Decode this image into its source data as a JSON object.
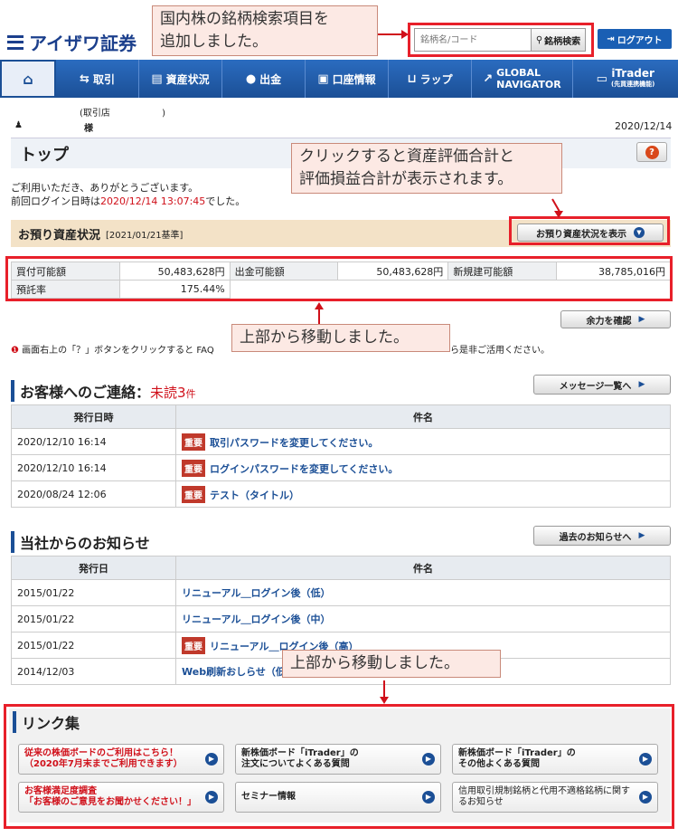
{
  "header": {
    "logo_text": "アイザワ証券",
    "search_placeholder": "銘柄名/コード",
    "search_button": "銘柄検索",
    "logout_label": "ログアウト"
  },
  "nav": {
    "items": [
      {
        "label": "取引",
        "icon": "exchange-icon"
      },
      {
        "label": "資産状況",
        "icon": "assets-icon"
      },
      {
        "label": "出金",
        "icon": "money-bag-icon"
      },
      {
        "label": "口座情報",
        "icon": "account-icon"
      },
      {
        "label": "ラップ",
        "icon": "wrap-icon"
      },
      {
        "label1": "GLOBAL",
        "label2": "NAVIGATOR",
        "icon": "external-icon"
      },
      {
        "label1": "iTrader",
        "label2": "(先買連携機能)",
        "icon": "monitor-icon"
      }
    ]
  },
  "user": {
    "branch": "(取引店",
    "branch_close": ")",
    "name_suffix": "様",
    "date": "2020/12/14"
  },
  "page": {
    "title": "トップ",
    "welcome": "ご利用いただき、ありがとうございます。",
    "last_login_prefix": "前回ログイン日時は",
    "last_login_time": "2020/12/14 13:07:45",
    "last_login_suffix": "でした。"
  },
  "assets": {
    "title": "お預り資産状況",
    "basis": "[2021/01/21基準]",
    "show_button": "お預り資産状況を表示",
    "rows": [
      {
        "l1": "買付可能額",
        "v1": "50,483,628円",
        "l2": "出金可能額",
        "v2": "50,483,628円",
        "l3": "新規建可能額",
        "v3": "38,785,016円"
      },
      {
        "l1": "預託率",
        "v1": "175.44%"
      }
    ],
    "margin_button": "余力を確認"
  },
  "notice": {
    "left": "画面右上の「？」ボタンをクリックすると FAQ",
    "right": "ら是非ご活用ください。"
  },
  "messages": {
    "title": "お客様へのご連絡：",
    "unread_label": "未読3",
    "unread_suffix": "件",
    "list_button": "メッセージ一覧へ",
    "col_date": "発行日時",
    "col_subject": "件名",
    "rows": [
      {
        "date": "2020/12/10 16:14",
        "badge": "重要",
        "subject": "取引パスワードを変更してください。"
      },
      {
        "date": "2020/12/10 16:14",
        "badge": "重要",
        "subject": "ログインパスワードを変更してください。"
      },
      {
        "date": "2020/08/24 12:06",
        "badge": "重要",
        "subject": "テスト（タイトル）"
      }
    ]
  },
  "news": {
    "title": "当社からのお知らせ",
    "past_button": "過去のお知らせへ",
    "col_date": "発行日",
    "col_subject": "件名",
    "rows": [
      {
        "date": "2015/01/22",
        "badge": "",
        "subject": "リニューアル＿ログイン後（低）"
      },
      {
        "date": "2015/01/22",
        "badge": "",
        "subject": "リニューアル＿ログイン後（中）"
      },
      {
        "date": "2015/01/22",
        "badge": "重要",
        "subject": "リニューアル＿ログイン後（高）"
      },
      {
        "date": "2014/12/03",
        "badge": "",
        "subject": "Web刷新おしらせ（低）"
      }
    ]
  },
  "links": {
    "title": "リンク集",
    "tiles": [
      {
        "line1": "従来の株価ボードのご利用はこちら！",
        "line2": "（2020年7月末までご利用できます）",
        "red": true
      },
      {
        "line1": "新株価ボード「iTrader」の",
        "line2": "注文についてよくある質問",
        "red": false
      },
      {
        "line1": "新株価ボード「iTrader」の",
        "line2": "その他よくある質問",
        "red": false
      },
      {
        "line1": "お客様満足度調査",
        "line2": "「お客様のご意見をお聞かせください！」",
        "red": true
      },
      {
        "line1": "セミナー情報",
        "line2": "",
        "red": false
      },
      {
        "line1": "信用取引規制銘柄と代用不適格銘柄に関す",
        "line2": "るお知らせ",
        "red": false
      }
    ]
  },
  "callouts": {
    "search": [
      "国内株の銘柄検索項目を",
      "追加しました。"
    ],
    "assets": [
      "クリックすると資産評価合計と",
      "評価損益合計が表示されます。"
    ],
    "moved1": "上部から移動しました。",
    "moved2": "上部から移動しました。"
  },
  "colors": {
    "accent_red": "#e8202a",
    "nav_blue": "#1b4f96",
    "callout_bg": "#fce9e4"
  }
}
